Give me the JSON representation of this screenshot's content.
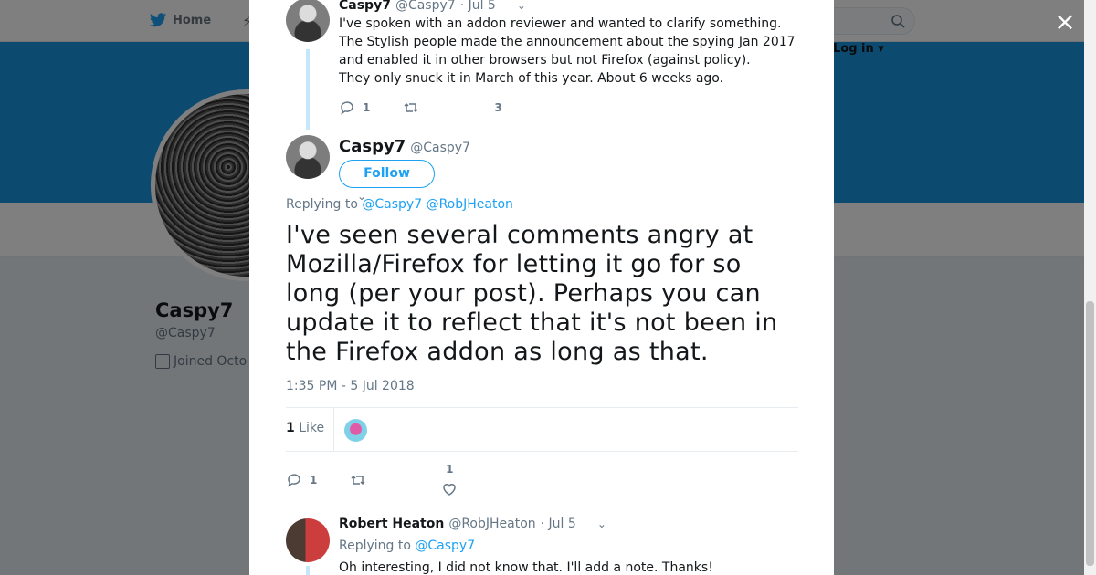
{
  "topbar": {
    "home_label": "Home",
    "login_label": "Log in ▾"
  },
  "profile": {
    "name": "Caspy7",
    "handle": "@Caspy7",
    "joined": "Joined Octo"
  },
  "modal": {
    "close_label": "×",
    "prev_tweet": {
      "name": "Caspy7",
      "handle": "@Caspy7",
      "time": "· Jul 5",
      "lines": [
        "I've spoken with an addon reviewer and wanted to clarify something.",
        "The Stylish people made the announcement about the spying Jan 2017",
        "and enabled it in other browsers but not Firefox (against policy).",
        "They only snuck it in March of this year. About 6 weeks ago."
      ],
      "reply_count": "1",
      "like_count": "3"
    },
    "main_tweet": {
      "name": "Caspy7",
      "handle": "@Caspy7",
      "follow_label": "Follow",
      "replying_prefix": "Replying to",
      "replying_to": [
        "@Caspy7",
        "@RobJHeaton"
      ],
      "text": "I've seen several comments angry at Mozilla/Firefox for letting it go for so long (per your post). Perhaps you can update it to reflect that it's not been in the Firefox addon as long as that.",
      "timestamp": "1:35 PM - 5 Jul 2018",
      "likes_count": "1",
      "likes_label": "Like",
      "reply_count": "1",
      "like_count": "1"
    },
    "reply_tweet": {
      "name": "Robert Heaton",
      "handle": "@RobJHeaton",
      "time": "· Jul 5",
      "replying_prefix": "Replying to",
      "replying_to": "@Caspy7",
      "text": "Oh interesting, I did not know that. I'll add a note. Thanks!"
    }
  },
  "colors": {
    "accent": "#1da1f2",
    "banner": "#1b95e0",
    "muted": "#657786"
  }
}
